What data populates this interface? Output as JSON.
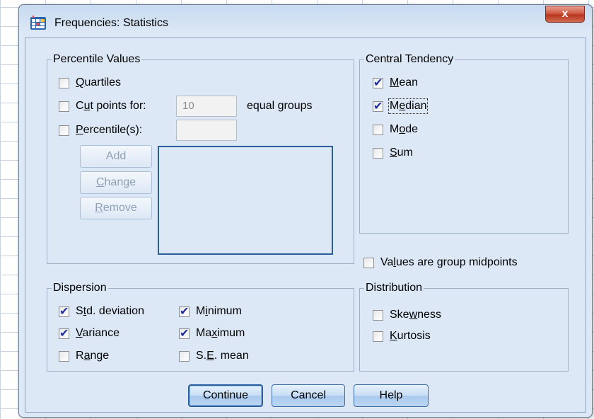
{
  "window": {
    "title": "Frequencies: Statistics",
    "close_label": "x"
  },
  "percentile_values": {
    "title": "Percentile Values",
    "quartiles": {
      "label": "Quartiles",
      "checked": false
    },
    "cut_points": {
      "label": "Cut points for:",
      "value": "10",
      "suffix": "equal groups",
      "checked": false
    },
    "percentiles": {
      "label": "Percentile(s):",
      "value": "",
      "checked": false
    },
    "add_label": "Add",
    "change_label": "Change",
    "remove_label": "Remove"
  },
  "central_tendency": {
    "title": "Central Tendency",
    "mean": {
      "label": "Mean",
      "checked": true
    },
    "median": {
      "label": "Median",
      "checked": true
    },
    "mode": {
      "label": "Mode",
      "checked": false
    },
    "sum": {
      "label": "Sum",
      "checked": false
    }
  },
  "group_midpoints": {
    "label": "Values are group midpoints",
    "checked": false
  },
  "dispersion": {
    "title": "Dispersion",
    "std_deviation": {
      "label": "Std. deviation",
      "checked": true
    },
    "minimum": {
      "label": "Minimum",
      "checked": true
    },
    "variance": {
      "label": "Variance",
      "checked": true
    },
    "maximum": {
      "label": "Maximum",
      "checked": true
    },
    "range": {
      "label": "Range",
      "checked": false
    },
    "se_mean": {
      "label": "S.E. mean",
      "checked": false
    }
  },
  "distribution": {
    "title": "Distribution",
    "skewness": {
      "label": "Skewness",
      "checked": false
    },
    "kurtosis": {
      "label": "Kurtosis",
      "checked": false
    }
  },
  "buttons": {
    "continue": "Continue",
    "cancel": "Cancel",
    "help": "Help"
  },
  "colors": {
    "dialog_bg": "#dce8f6",
    "check_color": "#1f2f9c",
    "close_button": "#c8452d"
  }
}
